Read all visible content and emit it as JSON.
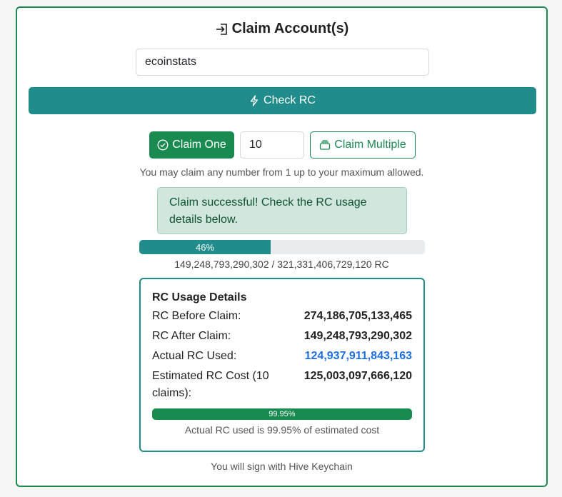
{
  "header": {
    "title": "Claim Account(s)",
    "icon": "login-icon"
  },
  "username": {
    "value": "ecoinstats",
    "placeholder": ""
  },
  "check_button": {
    "label": "Check RC",
    "icon": "lightning-icon"
  },
  "claim_one": {
    "label": "Claim One",
    "icon": "check-circle-icon"
  },
  "quantity": {
    "value": "10"
  },
  "claim_multiple": {
    "label": "Claim Multiple",
    "icon": "layers-icon"
  },
  "hint": "You may claim any number from 1 up to your maximum allowed.",
  "alert": {
    "text": "Claim successful! Check the RC usage details below."
  },
  "rc_progress": {
    "percent_label": "46%",
    "fraction": 0.46,
    "text": "149,248,793,290,302 / 321,331,406,729,120 RC"
  },
  "details": {
    "title": "RC Usage Details",
    "rows": [
      {
        "label": "RC Before Claim:",
        "value": "274,186,705,133,465"
      },
      {
        "label": "RC After Claim:",
        "value": "149,248,793,290,302"
      },
      {
        "label": "Actual RC Used:",
        "value": "124,937,911,843,163"
      },
      {
        "label": "Estimated RC Cost (10 claims):",
        "value": "125,003,097,666,120"
      }
    ],
    "usage_percent_label": "99.95%",
    "usage_fraction": 0.9995,
    "usage_caption": "Actual RC used is 99.95% of estimated cost"
  },
  "footer": "You will sign with Hive Keychain",
  "colors": {
    "accent": "#218c8c",
    "success": "#198a50",
    "highlight": "#1f6fe0",
    "alert_bg": "#d1e7dd"
  }
}
